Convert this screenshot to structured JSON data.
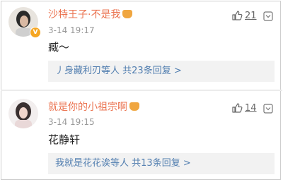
{
  "comments": [
    {
      "username": "沙特王子·不是我",
      "time": "3-14 19:17",
      "text": "臧～",
      "likes": "21",
      "reply_names": "丿身藏利刃等人",
      "reply_count": "共23条回复",
      "reply_arrow": ">",
      "verified_badge": "V"
    },
    {
      "username": "就是你的小祖宗啊",
      "time": "3-14 19:15",
      "text": "花静轩",
      "likes": "14",
      "reply_names": "我就是花花诶等人",
      "reply_count": "共13条回复",
      "reply_arrow": ">"
    }
  ],
  "colors": {
    "username": "#eb7350",
    "link": "#507daf",
    "time": "#999999",
    "reply_bg": "#f2f2f2",
    "badge": "#f5a623"
  },
  "icons": [
    "avatar",
    "verified-badge-icon",
    "crown-badge-icon",
    "thumbs-up-icon",
    "more-options-icon"
  ]
}
